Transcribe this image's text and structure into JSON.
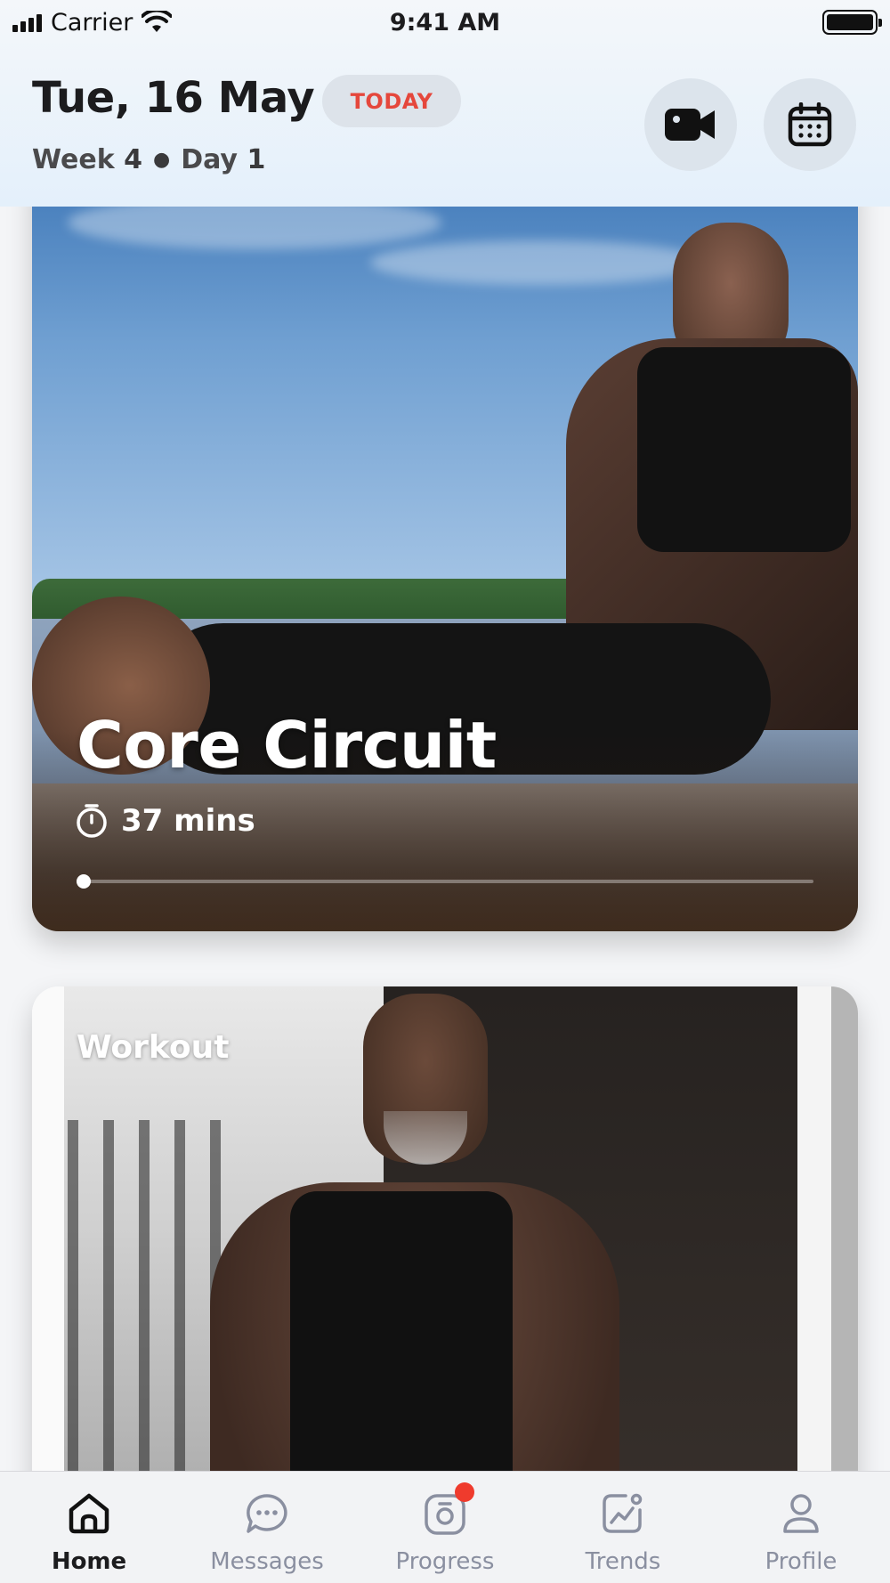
{
  "status_bar": {
    "carrier": "Carrier",
    "time": "9:41 AM"
  },
  "header": {
    "date": "Tue, 16 May",
    "today_badge": "TODAY",
    "week_label": "Week",
    "week_number": "4",
    "day_label": "Day",
    "day_number": "1",
    "accent_color": "#e5473c"
  },
  "cards": [
    {
      "title": "Core Circuit",
      "duration": "37 mins",
      "progress": 0.01,
      "icon": "stopwatch-icon"
    },
    {
      "label": "Workout"
    }
  ],
  "tab_bar": {
    "active": "Home",
    "items": [
      {
        "label": "Home",
        "icon": "home-icon"
      },
      {
        "label": "Messages",
        "icon": "chat-icon"
      },
      {
        "label": "Progress",
        "icon": "camera-icon",
        "has_badge": true
      },
      {
        "label": "Trends",
        "icon": "trend-chart-icon"
      },
      {
        "label": "Profile",
        "icon": "person-icon"
      }
    ]
  }
}
